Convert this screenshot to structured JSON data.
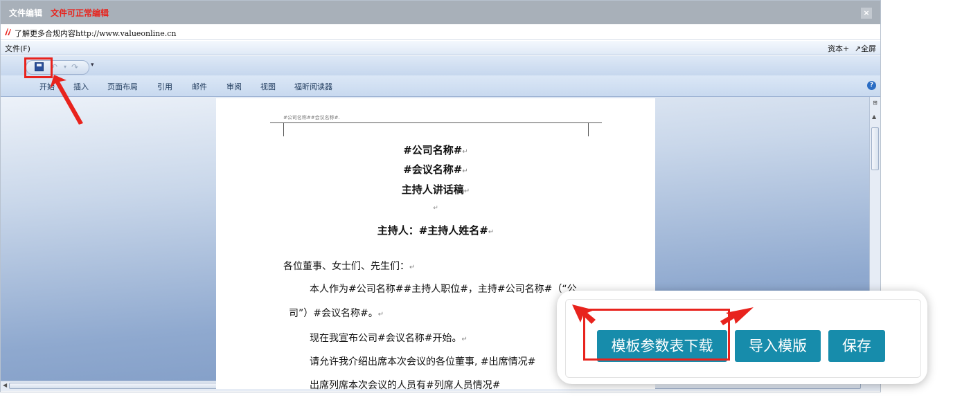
{
  "titlebar": {
    "title": "文件编辑",
    "subtitle": "文件可正常编辑",
    "subtitle_color": "#e8231d",
    "close_icon": "×"
  },
  "infobar": {
    "text": "了解更多合规内容http://www.valueonline.cn"
  },
  "menubar": {
    "file": "文件(F)",
    "right_items": [
      "资本+",
      "↗全屏"
    ]
  },
  "quick_access": {
    "buttons": [
      "save-icon",
      "undo-icon",
      "redo-icon"
    ],
    "more": "▾"
  },
  "ribbon": {
    "tabs": [
      "开始",
      "插入",
      "页面布局",
      "引用",
      "邮件",
      "审阅",
      "视图",
      "福昕阅读器"
    ]
  },
  "document": {
    "header_text": "#公司名称##会议名称#.",
    "title_lines": [
      "#公司名称#",
      "#会议名称#",
      "主持人讲话稿"
    ],
    "host_line": "主持人：#主持人姓名#",
    "paragraph_mark": "↵",
    "salutation": "各位董事、女士们、先生们：",
    "para1_line1": "本人作为#公司名称##主持人职位#，主持#公司名称#（“公",
    "para1_line2": "司”）#会议名称#。",
    "para2": "现在我宣布公司#会议名称#开始。",
    "para3": "请允许我介绍出席本次会议的各位董事, #出席情况#",
    "para4": "出席列席本次会议的人员有#列席人员情况#"
  },
  "actions": {
    "download_template": "模板参数表下载",
    "import_template": "导入模版",
    "save": "保存"
  },
  "colors": {
    "accent_button": "#178cab",
    "highlight": "#e8231d"
  }
}
